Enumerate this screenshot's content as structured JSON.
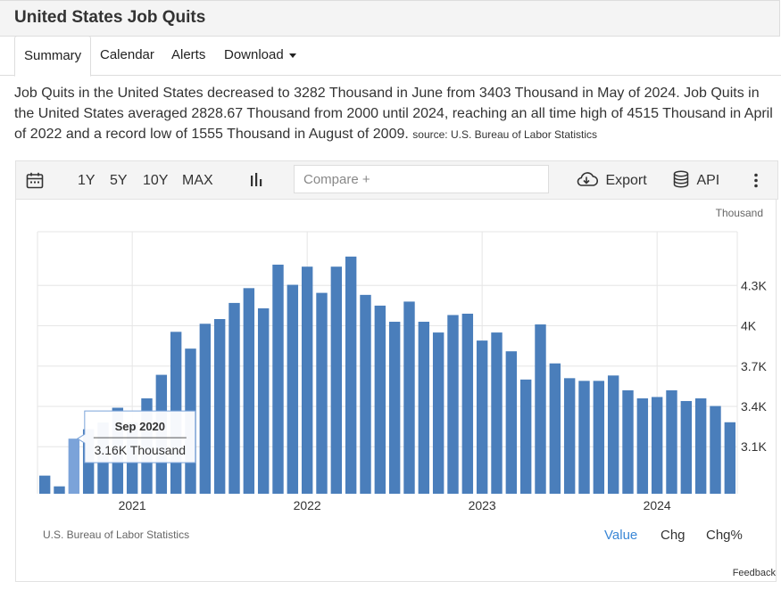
{
  "header": {
    "title": "United States Job Quits"
  },
  "tabs": [
    {
      "label": "Summary"
    },
    {
      "label": "Calendar"
    },
    {
      "label": "Alerts"
    },
    {
      "label": "Download"
    }
  ],
  "description": {
    "text": "Job Quits in the United States decreased to 3282 Thousand in June from 3403 Thousand in May of 2024. Job Quits in the United States averaged 2828.67 Thousand from 2000 until 2024, reaching an all time high of 4515 Thousand in April of 2022 and a record low of 1555 Thousand in August of 2009.",
    "source": "source: U.S. Bureau of Labor Statistics"
  },
  "toolbar": {
    "ranges": [
      "1Y",
      "5Y",
      "10Y",
      "MAX"
    ],
    "compare_placeholder": "Compare +",
    "export_label": "Export",
    "api_label": "API"
  },
  "chart_footer": {
    "attribution": "U.S. Bureau of Labor Statistics",
    "view_buttons": [
      "Value",
      "Chg",
      "Chg%"
    ],
    "feedback": "Feedback"
  },
  "colors": {
    "bar": "#4a7ebb",
    "bar_highlight": "#7ba3d9",
    "active_view": "#3a87d6"
  },
  "chart_data": {
    "type": "bar",
    "units": "Thousand",
    "x": [
      "2020-07",
      "2020-08",
      "2020-09",
      "2020-10",
      "2020-11",
      "2020-12",
      "2021-01",
      "2021-02",
      "2021-03",
      "2021-04",
      "2021-05",
      "2021-06",
      "2021-07",
      "2021-08",
      "2021-09",
      "2021-10",
      "2021-11",
      "2021-12",
      "2022-01",
      "2022-02",
      "2022-03",
      "2022-04",
      "2022-05",
      "2022-06",
      "2022-07",
      "2022-08",
      "2022-09",
      "2022-10",
      "2022-11",
      "2022-12",
      "2023-01",
      "2023-02",
      "2023-03",
      "2023-04",
      "2023-05",
      "2023-06",
      "2023-07",
      "2023-08",
      "2023-09",
      "2023-10",
      "2023-11",
      "2023-12",
      "2024-01",
      "2024-02",
      "2024-03",
      "2024-04",
      "2024-05",
      "2024-06"
    ],
    "values": [
      2885,
      2805,
      3160,
      3230,
      3280,
      3390,
      3280,
      3460,
      3635,
      3955,
      3830,
      4015,
      4050,
      4170,
      4280,
      4130,
      4455,
      4305,
      4440,
      4245,
      4440,
      4515,
      4230,
      4150,
      4030,
      4180,
      4030,
      3950,
      4080,
      4090,
      3890,
      3950,
      3810,
      3600,
      4010,
      3720,
      3610,
      3590,
      3590,
      3630,
      3520,
      3460,
      3470,
      3520,
      3440,
      3460,
      3403,
      3282
    ],
    "x_tick_labels": [
      "2021",
      "2022",
      "2023",
      "2024"
    ],
    "y_ticks": [
      3100,
      3400,
      3700,
      4000,
      4300
    ],
    "y_tick_labels": [
      "3.1K",
      "3.4K",
      "3.7K",
      "4K",
      "4.3K"
    ],
    "ylim": [
      2750,
      4700
    ],
    "grid": true,
    "tooltip": {
      "index": 2,
      "date": "Sep 2020",
      "value_text": "3.16K Thousand"
    }
  }
}
